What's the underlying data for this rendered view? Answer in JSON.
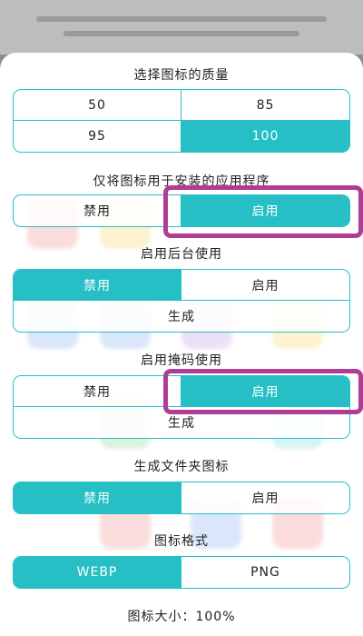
{
  "quality": {
    "title": "选择图标的质量",
    "options": [
      "50",
      "85",
      "95",
      "100"
    ],
    "selected": "100"
  },
  "installed_only": {
    "title": "仅将图标用于安装的应用程序",
    "disable": "禁用",
    "enable": "启用",
    "selected": "enable"
  },
  "background": {
    "title": "启用后台使用",
    "disable": "禁用",
    "enable": "启用",
    "generate": "生成",
    "selected": "disable"
  },
  "mask": {
    "title": "启用掩码使用",
    "disable": "禁用",
    "enable": "启用",
    "generate": "生成",
    "selected": "enable"
  },
  "folder_icon": {
    "title": "生成文件夹图标",
    "disable": "禁用",
    "enable": "启用",
    "selected": "disable"
  },
  "format": {
    "title": "图标格式",
    "options": [
      "WEBP",
      "PNG"
    ],
    "selected": "WEBP"
  },
  "size": {
    "title": "图标大小：100%"
  },
  "colors": {
    "accent": "#26bfc5",
    "highlight": "#b13c96"
  }
}
